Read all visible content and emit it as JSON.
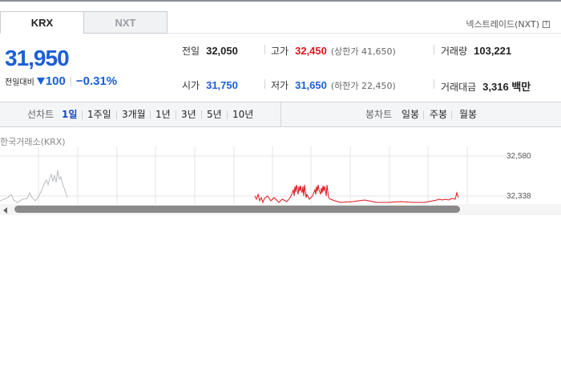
{
  "tabs": {
    "krx": "KRX",
    "nxt": "NXT"
  },
  "nxt_link": {
    "label": "넥스트레이드(NXT)",
    "help_icon": "help-icon"
  },
  "price": {
    "current": "31,950",
    "diff_label": "전일대비",
    "diff_icon": "down-triangle-icon",
    "diff_value": "100",
    "diff_pct": "−0.31%"
  },
  "stats": {
    "prev_close": {
      "label": "전일",
      "value": "32,050"
    },
    "high": {
      "label": "고가",
      "value": "32,450",
      "limit": "(상한가 41,650)"
    },
    "volume": {
      "label": "거래량",
      "value": "103,221"
    },
    "open": {
      "label": "시가",
      "value": "31,750"
    },
    "low": {
      "label": "저가",
      "value": "31,650",
      "limit": "(하한가 22,450)"
    },
    "amount": {
      "label": "거래대금",
      "value": "3,316 백만"
    }
  },
  "toolbar": {
    "line_title": "선차트",
    "line_periods": [
      "1일",
      "1주일",
      "3개월",
      "1년",
      "3년",
      "5년",
      "10년"
    ],
    "candle_title": "봉차트",
    "candle_periods": [
      "일봉",
      "주봉",
      "월봉"
    ],
    "active": "1일"
  },
  "chart": {
    "source_label": "한국거래소(KRX)",
    "y_ticks": [
      "32,580",
      "32,338"
    ]
  },
  "colors": {
    "up": "#e0141b",
    "down": "#1a5fd6",
    "prev_series": "#b9bcc2",
    "active_tab": "#1a47b8"
  }
}
